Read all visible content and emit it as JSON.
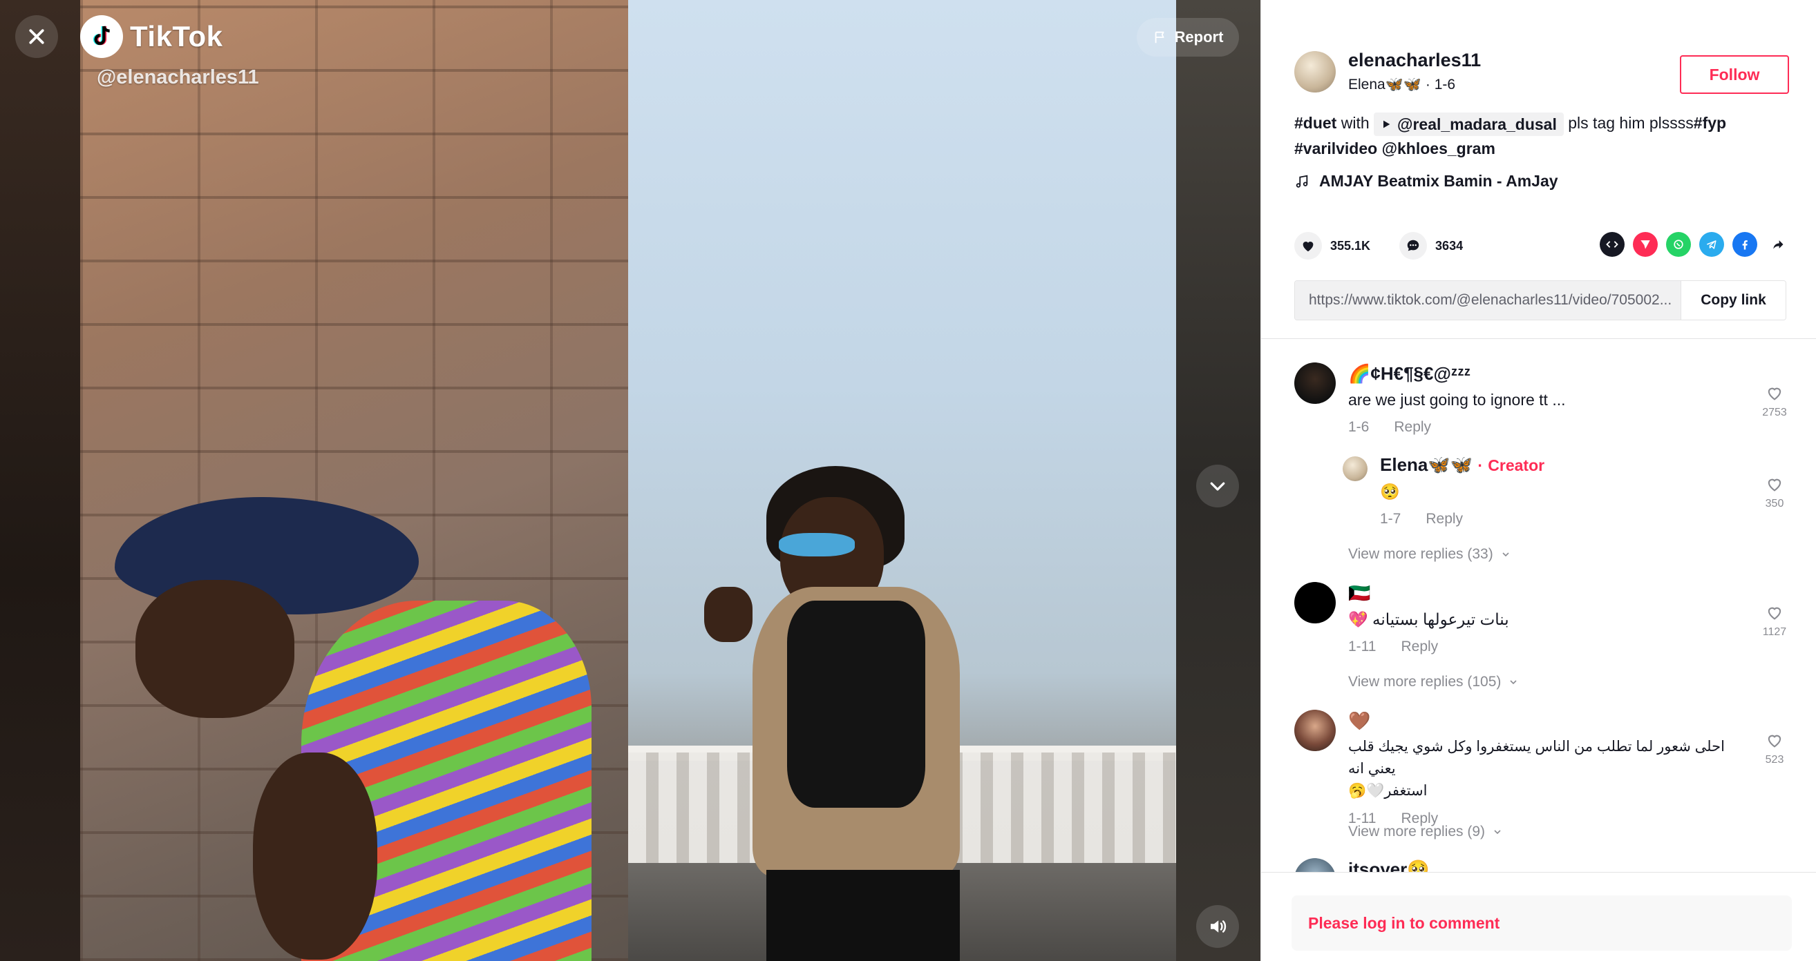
{
  "video": {
    "brand": "TikTok",
    "watermark_handle": "@elenacharles11",
    "report_label": "Report"
  },
  "author": {
    "username": "elenacharles11",
    "nickname": "Elena🦋🦋",
    "date": "1-6",
    "follow_label": "Follow"
  },
  "caption": {
    "hashtag_duet": "#duet",
    "with_text": "with",
    "duet_user": "@real_madara_dusal",
    "tail_text": "pls tag him plssss",
    "hashtag_fyp": "#fyp",
    "hashtag_varil": "#varilvideo",
    "mention": "@khloes_gram"
  },
  "music": {
    "title": "AMJAY Beatmix Bamin - AmJay"
  },
  "stats": {
    "likes": "355.1K",
    "comments": "3634"
  },
  "share": {
    "link_url": "https://www.tiktok.com/@elenacharles11/video/705002...",
    "copy_label": "Copy link"
  },
  "comments": [
    {
      "name": "🌈¢H€¶§€@ᶻᶻᶻ",
      "text": "are we just going to ignore tt ...",
      "date": "1-6",
      "reply_label": "Reply",
      "likes": "2753",
      "reply": {
        "name": "Elena🦋🦋",
        "badge_sep": "·",
        "badge": "Creator",
        "text": "🥺",
        "date": "1-7",
        "reply_label": "Reply",
        "likes": "350"
      },
      "view_more": "View more replies (33)"
    },
    {
      "name": "🇰🇼",
      "text": "بنات تيرعولها بستيانه 💖",
      "date": "1-11",
      "reply_label": "Reply",
      "likes": "1127",
      "view_more": "View more replies (105)"
    },
    {
      "name": "🤎",
      "text_line1": "احلى شعور لما تطلب من الناس يستغفروا وكل شوي يجيك قلب يعني انه",
      "text_line2": "استغفر🤍🥱",
      "date": "1-11",
      "reply_label": "Reply",
      "likes": "523",
      "view_more": "View more replies (9)"
    },
    {
      "name": "itsoyer🥺"
    }
  ],
  "footer": {
    "login_prompt": "Please log in to comment"
  },
  "colors": {
    "accent": "#fe2c55",
    "text_primary": "#161823",
    "text_secondary": "#8a8b91"
  }
}
